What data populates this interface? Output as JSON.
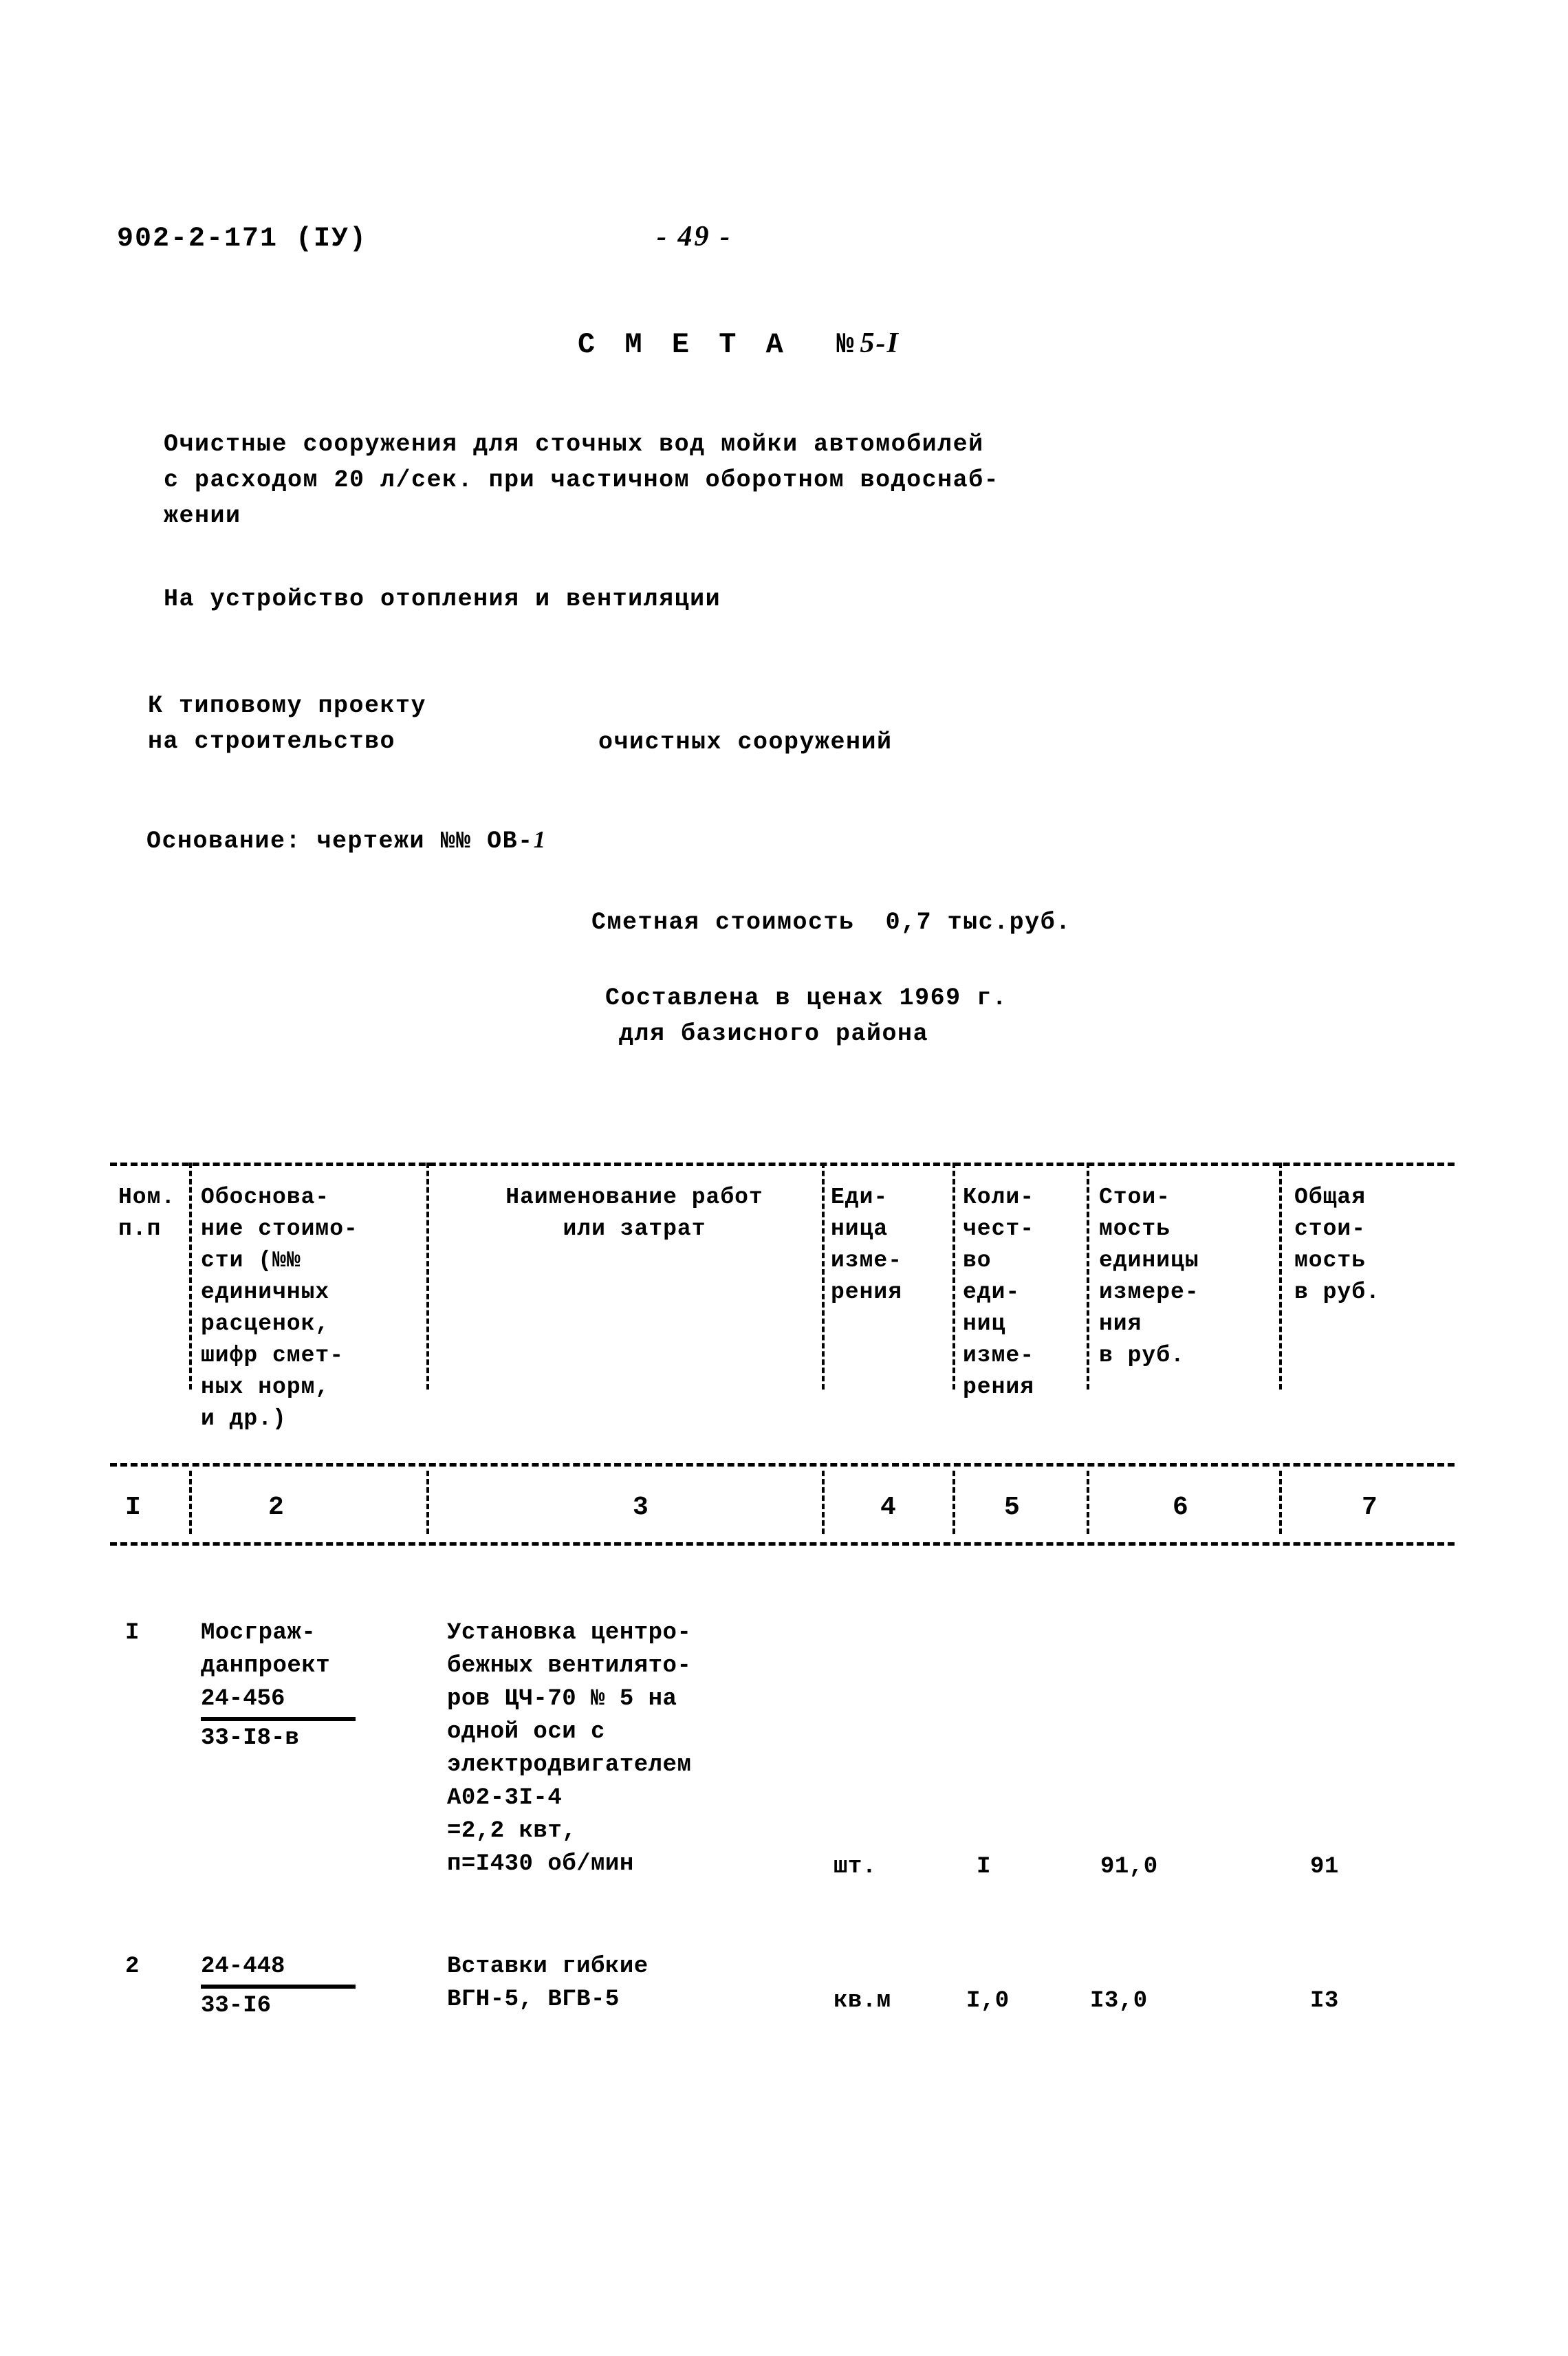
{
  "header": {
    "doc_code": "902-2-171 (IУ)",
    "page_number": "- 49 -"
  },
  "title": {
    "label": "С М Е Т А  №",
    "number": "5-I"
  },
  "intro": {
    "object_description": "Очистные сооружения для сточных вод мойки автомобилей\nс расходом 20 л/сек. при частичном оборотном водоснаб-\nжении",
    "work_type": "На устройство отопления и вентиляции",
    "project_label": "К типовому проекту\nна строительство",
    "project_value": "очистных сооружений",
    "basis_label": "Основание: чертежи №№ ОВ-",
    "basis_value": "1",
    "estimated_cost": "Сметная стоимость  0,7 тыс.руб.",
    "prices_year": "Составлена в ценах 1969 г.",
    "region": "для базисного района"
  },
  "table": {
    "headers": [
      "Ном.\nп.п",
      "Обоснова-\nние стоимо-\nсти (№№\nединичных\nрасценок,\nшифр смет-\nных норм,\nи др.)",
      "Наименование работ\nили затрат",
      "Еди-\nница\nизме-\nрения",
      "Коли-\nчест-\nво\nеди-\nниц\nизме-\nрения",
      "Стои-\nмость\nединицы\nизмере-\nния\nв руб.",
      "Общая\nстои-\nмость\nв руб."
    ],
    "column_numbers": [
      "I",
      "2",
      "3",
      "4",
      "5",
      "6",
      "7"
    ],
    "rows": [
      {
        "no": "I",
        "basis_text": "Мосграж-\nданпроект",
        "basis_numerator": "24-456",
        "basis_denominator": "33-I8-в",
        "description": "Установка центро-\nбежных вентилято-\nров ЦЧ-70 № 5 на\nодной оси с\nэлектродвигателем\nА02-3I-4\n   =2,2 квт,\nп=I430 об/мин",
        "unit": "шт.",
        "quantity": "I",
        "unit_cost": "91,0",
        "total_cost": "91"
      },
      {
        "no": "2",
        "basis_text": "",
        "basis_numerator": "24-448",
        "basis_denominator": "33-I6",
        "description": "Вставки гибкие\nВГН-5, ВГВ-5",
        "unit": "кв.м",
        "quantity": "I,0",
        "unit_cost": "I3,0",
        "total_cost": "I3"
      }
    ]
  },
  "colors": {
    "ink": "#000000",
    "paper": "#ffffff"
  }
}
